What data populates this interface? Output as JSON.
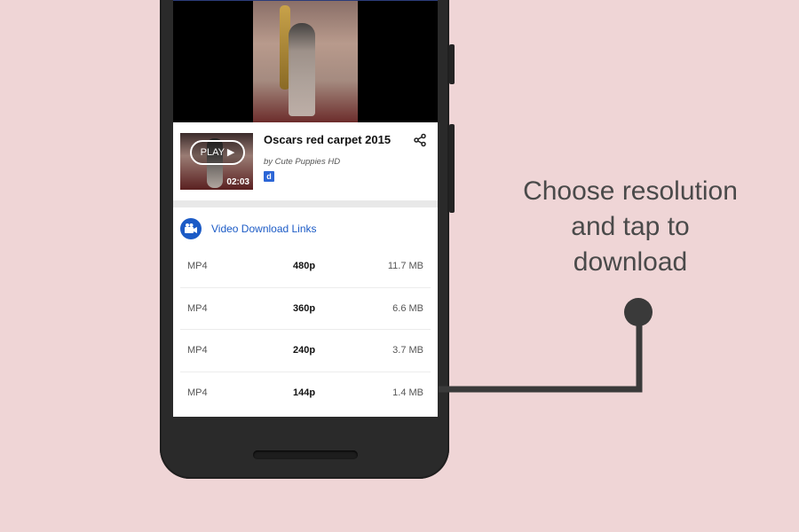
{
  "video": {
    "title": "Oscars red carpet 2015",
    "byline": "by Cute Puppies HD",
    "duration": "02:03",
    "play_label": "PLAY ▶",
    "badge": "d"
  },
  "links": {
    "header": "Video Download Links",
    "items": [
      {
        "format": "MP4",
        "resolution": "480p",
        "size": "11.7 MB"
      },
      {
        "format": "MP4",
        "resolution": "360p",
        "size": "6.6 MB"
      },
      {
        "format": "MP4",
        "resolution": "240p",
        "size": "3.7 MB"
      },
      {
        "format": "MP4",
        "resolution": "144p",
        "size": "1.4 MB"
      }
    ]
  },
  "callout": {
    "line1": "Choose resolution",
    "line2": "and tap to",
    "line3": "download"
  },
  "colors": {
    "background": "#efd5d6",
    "accent": "#1c5bc6",
    "phone_body": "#2a2a2a",
    "connector": "#3a3a3a"
  },
  "icons": [
    "share-icon",
    "video-camera-icon",
    "play-icon"
  ]
}
